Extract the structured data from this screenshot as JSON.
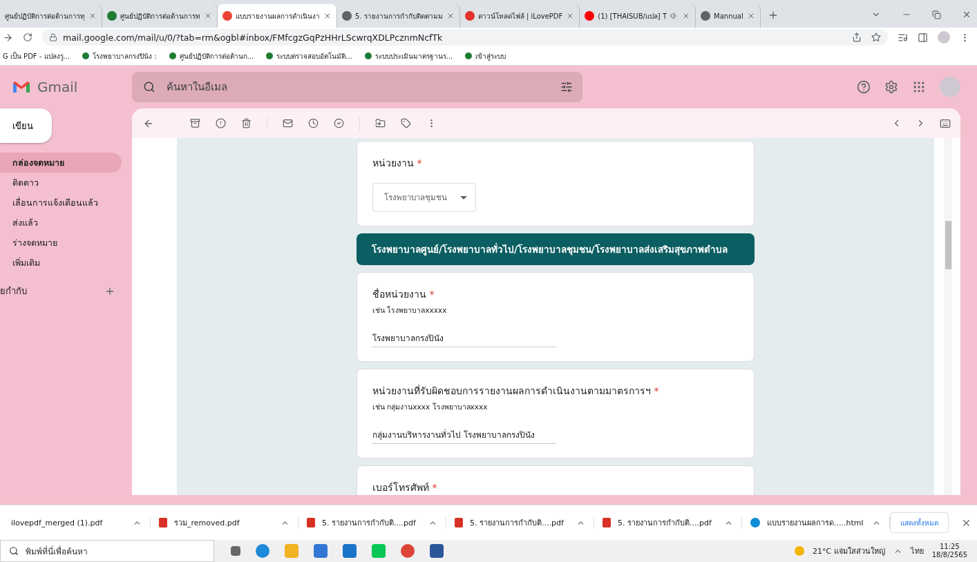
{
  "browser": {
    "tabs": [
      {
        "title": "ศูนย์ปฏิบัติการต่อต้านการทุ",
        "kind": "none",
        "selected": false
      },
      {
        "title": "ศูนย์ปฏิบัติการต่อต้านการท",
        "kind": "site",
        "selected": false
      },
      {
        "title": "แบบรายงานผลการดำเนินงา",
        "kind": "mail",
        "selected": true
      },
      {
        "title": "5. รายงานการกำกับติดตามม",
        "kind": "web",
        "selected": false
      },
      {
        "title": "ดาวน์โหลดไฟล์ | iLovePDF",
        "kind": "heart",
        "selected": false
      },
      {
        "title": "(1) [THAISUB/แปล] T",
        "kind": "video",
        "selected": false
      },
      {
        "title": "Mannual",
        "kind": "web",
        "selected": false
      }
    ],
    "address": "mail.google.com/mail/u/0/?tab=rm&ogbl#inbox/FMfcgzGqPzHHrLScwrqXDLPcznmNcfTk",
    "bookmarks": [
      "G เป็น PDF - แปลงรู...",
      "โรงพยาบาลกรงปินัง :",
      "ศูนย์ปฏิบัติการต่อต้านก...",
      "ระบบตรวจสอบอัตโนมัติ...",
      "ระบบประเมินมาตรฐานร...",
      "เข้าสู่ระบบ"
    ]
  },
  "gmail": {
    "logo": "Gmail",
    "search": {
      "placeholder": "ค้นหาในอีเมล"
    },
    "compose": "เขียน",
    "nav": [
      {
        "label": "กล่องจดหมาย",
        "selected": true
      },
      {
        "label": "ติดดาว",
        "selected": false
      },
      {
        "label": "เลื่อนการแจ้งเตือนแล้ว",
        "selected": false
      },
      {
        "label": "ส่งแล้ว",
        "selected": false
      },
      {
        "label": "ร่างจดหมาย",
        "selected": false
      },
      {
        "label": "เพิ่มเติม",
        "selected": false
      }
    ],
    "labels_heading": "ยกำกับ"
  },
  "form": [
    {
      "kind": "dropdown",
      "title": "หน่วยงาน",
      "mark": "*",
      "value": "โรงพยาบาลชุมชน"
    },
    {
      "kind": "header",
      "title": "โรงพยาบาลศูนย์/โรงพยาบาลทั่วไป/โรงพยาบาลชุมชน/โรงพยาบาลส่งเสริมสุขภาพตำบล"
    },
    {
      "kind": "text",
      "title": "ชื่อหน่วยงาน",
      "mark": "*",
      "hint": "เช่น โรงพยาบาลxxxxx",
      "value": "โรงพยาบาลกรงปินัง"
    },
    {
      "kind": "text",
      "title": "หน่วยงานที่รับผิดชอบการรายงานผลการดำเนินงานตามมาตรการฯ",
      "mark": "*",
      "hint": "เช่น กลุ่มงานxxxx  โรงพยาบาลxxxx",
      "value": "กลุ่มงานบริหารงานทั่วไป โรงพยาบาลกรงปินัง"
    },
    {
      "kind": "text",
      "title": "เบอร์โทรศัพท์",
      "mark": "*"
    }
  ],
  "downloads": {
    "items": [
      {
        "name": "ilovepdf_merged (1).pdf",
        "kind": "none"
      },
      {
        "name": "รวม_removed.pdf",
        "kind": "pdf"
      },
      {
        "name": "5. รายงานการกำกับติ....pdf",
        "kind": "pdf"
      },
      {
        "name": "5. รายงานการกำกับติ....pdf",
        "kind": "pdf"
      },
      {
        "name": "5. รายงานการกำกับติ....pdf",
        "kind": "pdf"
      },
      {
        "name": "แบบรายงานผลการด.....html",
        "kind": "edge"
      }
    ],
    "show_all": "แสดงทั้งหมด"
  },
  "taskbar": {
    "search": {
      "placeholder": "พิมพ์ที่นี่เพื่อค้นหา"
    },
    "weather": "21°C แจ่มใสส่วนใหญ่",
    "language": "ไทย",
    "time": "11:25",
    "date": "18/8/2565"
  }
}
